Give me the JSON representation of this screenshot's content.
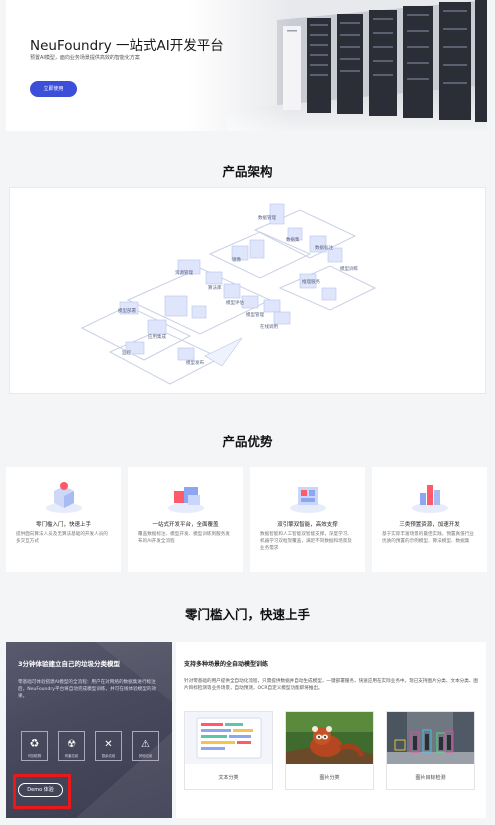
{
  "hero": {
    "title": "NeuFoundry 一站式AI开发平台",
    "subtitle": "预置AI模型，面向业务场景提供高效的智能化方案",
    "button_label": "立即使用"
  },
  "architecture": {
    "title": "产品架构",
    "labels": [
      "数据管理",
      "数据集",
      "数据标注",
      "模型训练",
      "模型评估",
      "模型部署",
      "模型管理",
      "推理服务",
      "在线调用",
      "应用集成",
      "算法库",
      "镜像管理",
      "资源管理"
    ]
  },
  "advantages": {
    "title": "产品优势",
    "items": [
      {
        "title": "零门槛入门，快速上手",
        "desc": "提供面向算法人员及无算法基础的开发人员的多交互方式"
      },
      {
        "title": "一站式开发平台，全面覆盖",
        "desc": "覆盖数据标注、模型开发、模型训练到服务发布的AI开发全流程"
      },
      {
        "title": "双引擎双智能，高效支撑",
        "desc": "数据智能和人工智能双智能支撑，深度学习、机器学习双框架覆盖，满足不同数据和场景及业务需求"
      },
      {
        "title": "三类预置资源，加速开发",
        "desc": "基于实际丰富场景的最佳实践，预置真值行业优质的预置的示例模型、算法模型、数据集"
      }
    ]
  },
  "quickstart": {
    "title": "零门槛入门，快速上手",
    "left_title": "3分钟体验建立自己的垃圾分类模型",
    "left_desc": "零基础可体验搭建AI模型的全流程：用户在对网络的数据集进行标注后，NeuFoundry平台将自动完成模型训练，并可在线体验模型的效果。",
    "icons": [
      "可回收物",
      "有害垃圾",
      "厨余垃圾",
      "其他垃圾"
    ],
    "demo_label": "Demo 体验",
    "right_title": "支持多种场景的全自动模型训练",
    "right_desc": "针对零基础的用户提供全自动化流程，只需提供数据并自动生成模型，一键部署服务，快速应用在实际业务中。现已支持图片分类、文本分类、图片目标检测等业务场景，自动预测，OCR自定义模型功能即将推出。",
    "cards": [
      "文本分类",
      "图片分类",
      "图片目标检测"
    ]
  },
  "colors": {
    "accent": "#3b4fd8",
    "highlight": "#e8181b"
  }
}
